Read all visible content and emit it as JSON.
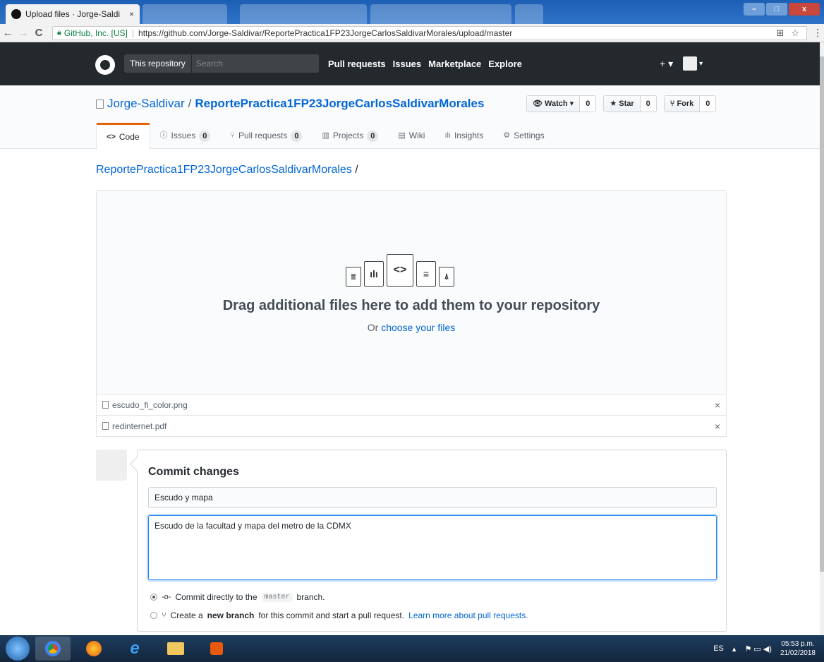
{
  "browser": {
    "tab_title": "Upload files · Jorge-Saldi",
    "tab_close": "×",
    "secure_label": "GitHub, Inc. [US]",
    "url": "https://github.com/Jorge-Saldivar/ReportePractica1FP23JorgeCarlosSaldivarMorales/upload/master",
    "back": "←",
    "forward": "→",
    "reload": "C",
    "translate": "⊞",
    "star": "☆",
    "menu": "⋮",
    "min": "–",
    "max": "□",
    "close": "x"
  },
  "header": {
    "scope": "This repository",
    "search_placeholder": "Search",
    "nav": [
      "Pull requests",
      "Issues",
      "Marketplace",
      "Explore"
    ],
    "plus": "+ ▾",
    "avatar_caret": "▾"
  },
  "repo": {
    "owner": "Jorge-Saldivar",
    "slash": "/",
    "name": "ReportePractica1FP23JorgeCarlosSaldivarMorales",
    "watch_label": "Watch ▾",
    "watch_count": "0",
    "star_label": "Star",
    "star_count": "0",
    "fork_label": "Fork",
    "fork_count": "0",
    "tabs": [
      {
        "label": "Code",
        "icon": "<>",
        "count": ""
      },
      {
        "label": "Issues",
        "icon": "ⓘ",
        "count": "0"
      },
      {
        "label": "Pull requests",
        "icon": "⑂",
        "count": "0"
      },
      {
        "label": "Projects",
        "icon": "▥",
        "count": "0"
      },
      {
        "label": "Wiki",
        "icon": "▤",
        "count": ""
      },
      {
        "label": "Insights",
        "icon": "ılı",
        "count": ""
      },
      {
        "label": "Settings",
        "icon": "⚙",
        "count": ""
      }
    ]
  },
  "upload": {
    "breadcrumb": "ReportePractica1FP23JorgeCarlosSaldivarMorales",
    "breadcrumb_sep": " /",
    "drop_title": "Drag additional files here to add them to your repository",
    "drop_or": "Or",
    "choose_link": "choose your files",
    "files": [
      {
        "name": "escudo_fi_color.png"
      },
      {
        "name": "redinternet.pdf"
      }
    ],
    "remove": "×"
  },
  "commit": {
    "title": "Commit changes",
    "summary": "Escudo y mapa",
    "description": "Escudo de la facultad y mapa del metro de la CDMX",
    "direct_prefix": "Commit directly to the",
    "branch": "master",
    "direct_suffix": "branch.",
    "new_prefix": "Create a",
    "new_bold": "new branch",
    "new_suffix": "for this commit and start a pull request.",
    "learn_more": "Learn more about pull requests."
  },
  "taskbar": {
    "lang": "ES",
    "time": "05:53 p.m.",
    "date": "21/02/2018",
    "tray_arrow": "▴",
    "tray_icons": "⚑ ▭ ◀)"
  },
  "colors": {
    "link": "#0366d6",
    "header_bg": "#24292e",
    "tab_accent": "#e36209"
  }
}
